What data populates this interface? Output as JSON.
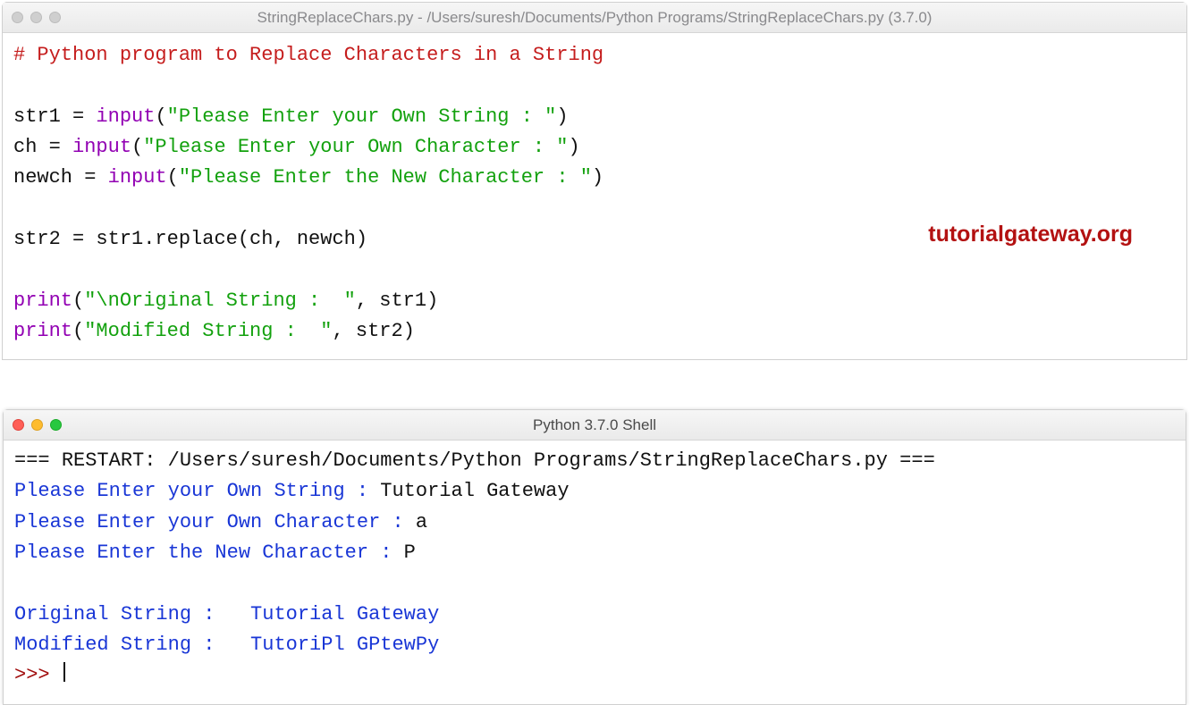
{
  "editor": {
    "title": "StringReplaceChars.py - /Users/suresh/Documents/Python Programs/StringReplaceChars.py (3.7.0)",
    "comment": "# Python program to Replace Characters in a String",
    "line_str1_var": "str1",
    "line_ch_var": "ch",
    "line_newch_var": "newch",
    "eq": " = ",
    "input_fn": "input",
    "open": "(",
    "close": ")",
    "prompt_str1": "\"Please Enter your Own String : \"",
    "prompt_ch": "\"Please Enter your Own Character : \"",
    "prompt_newch": "\"Please Enter the New Character : \"",
    "line_str2_var": "str2",
    "replace_call_prefix": "str1.replace(ch, newch)",
    "print_fn": "print",
    "print1_str": "\"\\nOriginal String :  \"",
    "print2_str": "\"Modified String :  \"",
    "comma_str1": ", str1",
    "comma_str2": ", str2",
    "watermark": "tutorialgateway.org"
  },
  "shell": {
    "title": "Python 3.7.0 Shell",
    "restart_prefix": "=== ",
    "restart_label": "RESTART: /Users/suresh/Documents/Python Programs/StringReplaceChars.py",
    "restart_suffix": " ===",
    "prompt1_label": "Please Enter your Own String : ",
    "prompt1_value": "Tutorial Gateway",
    "prompt2_label": "Please Enter your Own Character : ",
    "prompt2_value": "a",
    "prompt3_label": "Please Enter the New Character : ",
    "prompt3_value": "P",
    "out1_label": "Original String :   ",
    "out1_value": "Tutorial Gateway",
    "out2_label": "Modified String :   ",
    "out2_value": "TutoriPl GPtewPy",
    "prompt_sym": ">>> "
  }
}
